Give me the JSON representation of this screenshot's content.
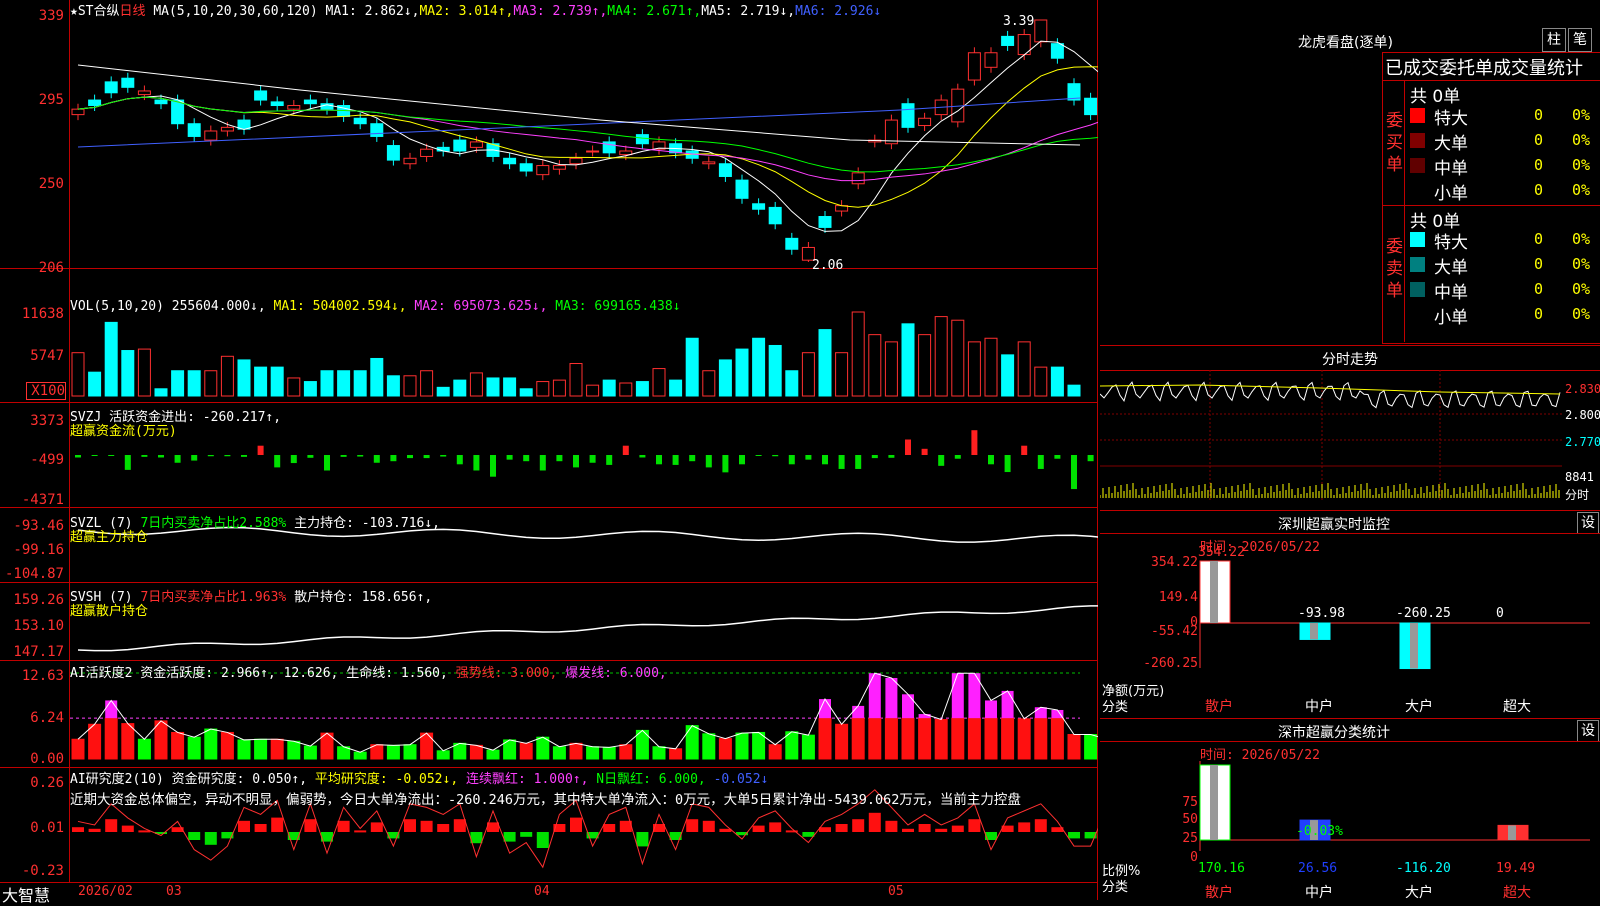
{
  "main": {
    "title_prefix": "★ST合纵",
    "period": "日线",
    "ma_label": "MA(5,10,20,30,60,120)",
    "ma1": "MA1: 2.862↓,",
    "ma2": "MA2: 3.014↑,",
    "ma3": "MA3: 2.739↑,",
    "ma4": "MA4: 2.671↑,",
    "ma5": "MA5: 2.719↓,",
    "ma6": "MA6: 2.926↓",
    "y_ticks": [
      "339",
      "295",
      "250",
      "206"
    ],
    "high_mark": "3.39",
    "low_mark": "2.06"
  },
  "vol": {
    "label": "VOL(5,10,20)",
    "value": "255604.000↓,",
    "ma1": "MA1: 504002.594↓,",
    "ma2": "MA2: 695073.625↓,",
    "ma3": "MA3: 699165.438↓",
    "y_ticks": [
      "11638",
      "5747",
      "X100"
    ]
  },
  "svzj": {
    "label": "SVZJ  活跃资金进出: -260.217↑,",
    "sub": "超赢资金流(万元)",
    "y_ticks": [
      "3373",
      "-499",
      "-4371"
    ]
  },
  "svzl": {
    "label": "SVZL (7)",
    "ratio": "7日内买卖净占比2.588%",
    "hold": "主力持仓: -103.716↓,",
    "sub": "超赢主力持仓",
    "y_ticks": [
      "-93.46",
      "-99.16",
      "-104.87"
    ]
  },
  "svsh": {
    "label": "SVSH (7)",
    "ratio": "7日内买卖净占比1.963%",
    "hold": "散户持仓: 158.656↑,",
    "sub": "超赢散户持仓",
    "y_ticks": [
      "159.26",
      "153.10",
      "147.17"
    ]
  },
  "ai1": {
    "label": "AI活跃度2 资金活跃度: 2.966↑,",
    "v2": "12.626,",
    "life": "生命线: 1.560,",
    "strong": "强势线: 3.000,",
    "burst": "爆发线: 6.000,",
    "y_ticks": [
      "12.63",
      "6.24",
      "0.00"
    ]
  },
  "ai2": {
    "label": "AI研究度2(10) 资金研究度: 0.050↑,",
    "avg": "平均研究度: -0.052↓,",
    "red": "连续飘红: 1.000↑,",
    "nred": "N日飘红: 6.000,",
    "last": "-0.052↓",
    "comment": "近期大资金总体偏空，异动不明显，偏弱势，今日大单净流出：-260.246万元，其中特大单净流入：0万元，大单5日累计净出-5439.062万元，当前主力控盘",
    "y_ticks": [
      "0.26",
      "0.01",
      "-0.23"
    ]
  },
  "xaxis": {
    "brand": "大智慧",
    "labels": [
      "2026/02",
      "03",
      "04",
      "05"
    ]
  },
  "right": {
    "lhb_title": "龙虎看盘(逐单)",
    "btn1": "柱",
    "btn2": "笔",
    "tabs": "已成交委托单成交量统计",
    "buy_side": "委买单",
    "sell_side": "委卖单",
    "buy_total": "共 0单",
    "sell_total": "共 0单",
    "rows": [
      {
        "name": "特大",
        "val": "0",
        "pct": "0%"
      },
      {
        "name": "大单",
        "val": "0",
        "pct": "0%"
      },
      {
        "name": "中单",
        "val": "0",
        "pct": "0%"
      },
      {
        "name": "小单",
        "val": "0",
        "pct": "0%"
      }
    ],
    "buy_colors": [
      "#ff0000",
      "#800000",
      "#600000",
      "#000000"
    ],
    "sell_colors": [
      "#00ffff",
      "#008080",
      "#006060",
      "#000000"
    ],
    "fs_title": "分时走势",
    "fs_ticks": [
      "2.830",
      "2.800",
      "2.770",
      "8841",
      "分时"
    ],
    "sz_title": "深圳超赢实时监控",
    "sz_time": "时间: 2026/05/22",
    "sz_btn": "设",
    "sz_ticks": [
      "354.22",
      "149.4",
      "0",
      "-55.42",
      "-260.25"
    ],
    "sz_values": [
      "354.22",
      "-93.98",
      "-260.25",
      "0"
    ],
    "sz_cats": [
      "散户",
      "中户",
      "大户",
      "超大"
    ],
    "sz_ylabel": "净额(万元)",
    "sz_xlabel": "分类",
    "sc_title": "深市超赢分类统计",
    "sc_time": "时间: 2026/05/22",
    "sc_btn": "设",
    "sc_ticks": [
      "75",
      "50",
      "25",
      "0"
    ],
    "sc_top": "-0.03%",
    "sc_values": [
      "170.16",
      "26.56",
      "-116.20",
      "19.49"
    ],
    "sc_cats": [
      "散户",
      "中户",
      "大户",
      "超大"
    ],
    "sc_ylabel": "比例%",
    "sc_xlabel": "分类"
  },
  "chart_data": {
    "type": "candlestick",
    "categories": [
      "2026/02",
      "03",
      "04",
      "05"
    ],
    "price_range": [
      2.06,
      3.39
    ],
    "price_ticks": [
      3.39,
      2.95,
      2.5,
      2.06
    ],
    "extremes": {
      "high": 3.39,
      "low": 2.06
    },
    "series": [
      {
        "name": "MA1",
        "last": 2.862
      },
      {
        "name": "MA2",
        "last": 3.014
      },
      {
        "name": "MA3",
        "last": 2.739
      },
      {
        "name": "MA4",
        "last": 2.671
      },
      {
        "name": "MA5",
        "last": 2.719
      },
      {
        "name": "MA6",
        "last": 2.926
      }
    ],
    "close": [
      2.9,
      2.92,
      2.99,
      3.02,
      3.0,
      2.93,
      2.82,
      2.75,
      2.78,
      2.8,
      2.79,
      2.95,
      2.92,
      2.92,
      2.93,
      2.9,
      2.86,
      2.82,
      2.75,
      2.62,
      2.63,
      2.68,
      2.67,
      2.67,
      2.72,
      2.64,
      2.6,
      2.56,
      2.59,
      2.59,
      2.63,
      2.67,
      2.66,
      2.67,
      2.71,
      2.72,
      2.66,
      2.63,
      2.61,
      2.53,
      2.41,
      2.35,
      2.27,
      2.13,
      2.14,
      2.25,
      2.37,
      2.55,
      2.73,
      2.84,
      2.8,
      2.85,
      2.95,
      3.01,
      3.21,
      3.21,
      3.25,
      3.31,
      3.39,
      3.18,
      2.95,
      2.87,
      2.93,
      2.91,
      2.83,
      2.85
    ],
    "open": [
      2.87,
      2.95,
      3.05,
      3.07,
      2.98,
      2.95,
      2.95,
      2.82,
      2.73,
      2.78,
      2.84,
      3.0,
      2.94,
      2.9,
      2.95,
      2.93,
      2.92,
      2.85,
      2.82,
      2.7,
      2.6,
      2.64,
      2.69,
      2.73,
      2.69,
      2.71,
      2.63,
      2.6,
      2.54,
      2.57,
      2.6,
      2.67,
      2.72,
      2.65,
      2.76,
      2.68,
      2.71,
      2.67,
      2.6,
      2.6,
      2.51,
      2.38,
      2.36,
      2.19,
      2.07,
      2.31,
      2.34,
      2.49,
      2.72,
      2.71,
      2.93,
      2.81,
      2.87,
      2.83,
      3.06,
      3.13,
      3.3,
      3.2,
      3.27,
      3.26,
      3.04,
      2.96,
      2.89,
      2.96,
      2.93,
      2.82
    ],
    "volume": [
      6000,
      3300,
      10200,
      6300,
      6500,
      1000,
      3500,
      3500,
      3500,
      5500,
      5000,
      4000,
      4000,
      2500,
      2000,
      3500,
      3500,
      3500,
      5200,
      2800,
      2800,
      3500,
      1200,
      2200,
      3200,
      2500,
      2500,
      1000,
      2000,
      2200,
      4500,
      1500,
      2200,
      1800,
      2000,
      3800,
      2200,
      8000,
      3500,
      5000,
      6500,
      8000,
      7000,
      3500,
      6000,
      9200,
      6000,
      11638,
      8500,
      7500,
      10000,
      8500,
      11000,
      10500,
      7500,
      8000,
      5700,
      7500,
      4000,
      4000,
      1500
    ],
    "svzj": [
      -80,
      -30,
      -20,
      -480,
      -60,
      -80,
      -250,
      -180,
      -40,
      -40,
      -60,
      300,
      -400,
      -260,
      -90,
      -500,
      -60,
      -50,
      -250,
      -200,
      -100,
      -100,
      -50,
      -300,
      -500,
      -700,
      -150,
      -200,
      -500,
      -200,
      -400,
      -250,
      -320,
      300,
      -80,
      -300,
      -320,
      -200,
      -400,
      -560,
      -300,
      -20,
      -40,
      -300,
      -150,
      -300,
      -450,
      -450,
      -100,
      -90,
      500,
      200,
      -350,
      -120,
      800,
      -300,
      -550,
      300,
      -450,
      -120,
      -1100,
      -200,
      -1000,
      200,
      -300,
      -40,
      -10
    ],
    "ai_activity": [
      2.9,
      5.1,
      8.6,
      5.2,
      2.9,
      5.6,
      3.9,
      3.2,
      4.4,
      3.9,
      2.8,
      2.9,
      2.9,
      2.6,
      1.9,
      3.8,
      1.8,
      1.0,
      2.1,
      2.0,
      2.1,
      3.8,
      1.2,
      2.3,
      2.0,
      1.3,
      2.8,
      2.3,
      3.2,
      1.8,
      2.3,
      1.8,
      1.7,
      2.1,
      4.2,
      1.8,
      1.5,
      4.9,
      3.7,
      3.0,
      3.8,
      3.9,
      2.1,
      4.0,
      3.5,
      8.8,
      5.1,
      7.8,
      12.6,
      11.9,
      9.5,
      6.6,
      5.8,
      12.6,
      12.6,
      8.6,
      10.0,
      5.9,
      7.6,
      7.2,
      3.6,
      3.6,
      2.9
    ],
    "ai_research": [
      0.03,
      0.02,
      0.08,
      0.04,
      0.01,
      -0.01,
      0.03,
      -0.05,
      -0.08,
      -0.04,
      0.07,
      0.05,
      0.09,
      -0.05,
      0.08,
      -0.06,
      0.07,
      0.01,
      0.06,
      -0.04,
      0.08,
      0.07,
      0.05,
      0.08,
      -0.07,
      0.06,
      -0.06,
      -0.03,
      -0.1,
      0.05,
      0.09,
      -0.04,
      0.05,
      0.07,
      -0.09,
      0.05,
      -0.05,
      0.08,
      0.07,
      0.02,
      -0.02,
      0.04,
      0.06,
      0.01,
      -0.03,
      0.03,
      0.05,
      0.08,
      0.12,
      0.07,
      0.02,
      0.05,
      0.02,
      0.04,
      0.08,
      -0.05,
      0.04,
      0.06,
      0.08,
      0.03,
      -0.04,
      -0.04,
      0.07,
      0.05,
      0.05
    ]
  }
}
